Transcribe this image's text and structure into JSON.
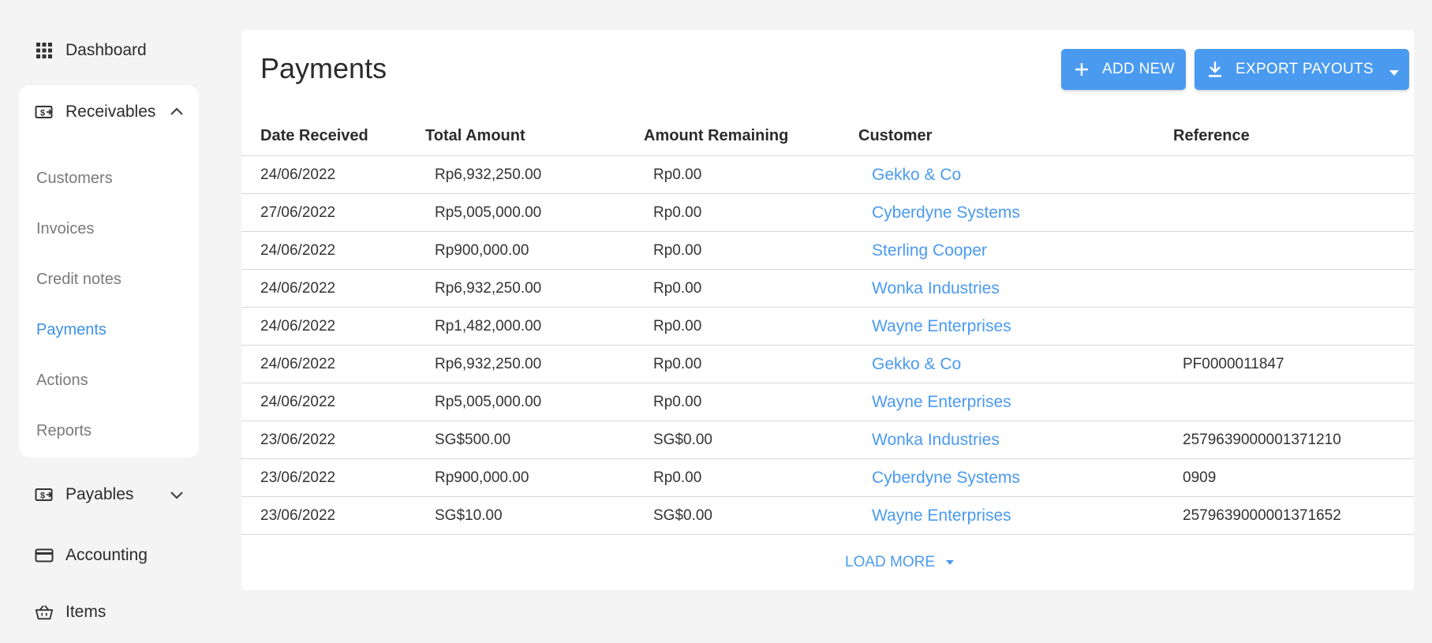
{
  "sidebar": {
    "dashboard": {
      "label": "Dashboard",
      "icon": "grid-icon"
    },
    "receivables": {
      "label": "Receivables",
      "icon": "cash-icon",
      "expanded": true,
      "items": [
        {
          "label": "Customers",
          "active": false
        },
        {
          "label": "Invoices",
          "active": false
        },
        {
          "label": "Credit notes",
          "active": false
        },
        {
          "label": "Payments",
          "active": true
        },
        {
          "label": "Actions",
          "active": false
        },
        {
          "label": "Reports",
          "active": false
        }
      ]
    },
    "payables": {
      "label": "Payables",
      "icon": "cash-icon",
      "expanded": false
    },
    "accounting": {
      "label": "Accounting",
      "icon": "credit-card-icon"
    },
    "items": {
      "label": "Items",
      "icon": "basket-icon"
    }
  },
  "main": {
    "title": "Payments",
    "add_button": "ADD NEW",
    "export_button": "EXPORT PAYOUTS",
    "columns": [
      "Date Received",
      "Total Amount",
      "Amount Remaining",
      "Customer",
      "Reference"
    ],
    "rows": [
      {
        "date": "24/06/2022",
        "total": "Rp6,932,250.00",
        "remaining": "Rp0.00",
        "customer": "Gekko & Co",
        "reference": ""
      },
      {
        "date": "27/06/2022",
        "total": "Rp5,005,000.00",
        "remaining": "Rp0.00",
        "customer": "Cyberdyne Systems",
        "reference": ""
      },
      {
        "date": "24/06/2022",
        "total": "Rp900,000.00",
        "remaining": "Rp0.00",
        "customer": "Sterling Cooper",
        "reference": ""
      },
      {
        "date": "24/06/2022",
        "total": "Rp6,932,250.00",
        "remaining": "Rp0.00",
        "customer": "Wonka Industries",
        "reference": ""
      },
      {
        "date": "24/06/2022",
        "total": "Rp1,482,000.00",
        "remaining": "Rp0.00",
        "customer": "Wayne Enterprises",
        "reference": ""
      },
      {
        "date": "24/06/2022",
        "total": "Rp6,932,250.00",
        "remaining": "Rp0.00",
        "customer": "Gekko & Co",
        "reference": "PF0000011847"
      },
      {
        "date": "24/06/2022",
        "total": "Rp5,005,000.00",
        "remaining": "Rp0.00",
        "customer": "Wayne Enterprises",
        "reference": ""
      },
      {
        "date": "23/06/2022",
        "total": "SG$500.00",
        "remaining": "SG$0.00",
        "customer": "Wonka Industries",
        "reference": "2579639000001371210"
      },
      {
        "date": "23/06/2022",
        "total": "Rp900,000.00",
        "remaining": "Rp0.00",
        "customer": "Cyberdyne Systems",
        "reference": "0909"
      },
      {
        "date": "23/06/2022",
        "total": "SG$10.00",
        "remaining": "SG$0.00",
        "customer": "Wayne Enterprises",
        "reference": "2579639000001371652"
      }
    ],
    "load_more": "LOAD MORE"
  },
  "colors": {
    "accent": "#4a9af0",
    "active_nav": "#3d8fe6",
    "background": "#f4f4f4",
    "card": "#ffffff"
  }
}
